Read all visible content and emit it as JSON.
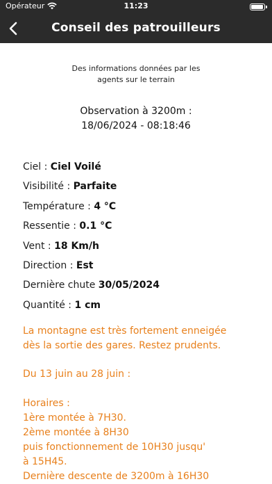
{
  "status_bar": {
    "carrier": "Opérateur",
    "time": "11:23"
  },
  "nav": {
    "title": "Conseil des patrouilleurs"
  },
  "subtitle": {
    "line1": "Des informations données par les",
    "line2": "agents sur le terrain"
  },
  "observation": {
    "line1": "Observation à 3200m :",
    "line2": "18/06/2024 - 08:18:46"
  },
  "fields": [
    {
      "label": "Ciel : ",
      "value": "Ciel Voilé"
    },
    {
      "label": "Visibilité : ",
      "value": "Parfaite"
    },
    {
      "label": "Température : ",
      "value": "4 °C"
    },
    {
      "label": "Ressentie : ",
      "value": "0.1 °C"
    },
    {
      "label": "Vent : ",
      "value": "18 Km/h"
    },
    {
      "label": "Direction : ",
      "value": "Est"
    },
    {
      "label": "Dernière chute ",
      "value": "30/05/2024"
    },
    {
      "label": "Quantité : ",
      "value": "1 cm"
    }
  ],
  "message": {
    "warning_line1": "La montagne est très fortement enneigée",
    "warning_line2": "dès la sortie des gares. Restez prudents.",
    "dates": "Du 13 juin au 28 juin :",
    "hours_lines": [
      "Horaires :",
      "1ère montée à 7H30.",
      "2ème montée à 8H30",
      "puis fonctionnement de 10H30 jusqu'",
      "à 15H45.",
      "Dernière descente de 3200m à 16H30"
    ]
  },
  "colors": {
    "header_bg": "#2b2b2b",
    "accent_orange": "#e8801c",
    "text": "#1c1c1c"
  },
  "icons": {
    "back": "chevron-left-icon",
    "wifi": "wifi-icon",
    "battery": "battery-icon"
  }
}
